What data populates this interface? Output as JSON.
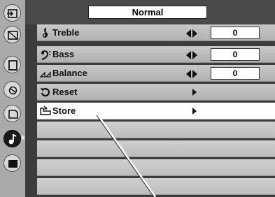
{
  "header": {
    "mode_value": "Normal"
  },
  "side_icons": [
    {
      "name": "input-icon"
    },
    {
      "name": "pc-adjust-icon"
    },
    {
      "name": "screen-icon"
    },
    {
      "name": "image-select-icon"
    },
    {
      "name": "image-adjust-icon"
    },
    {
      "name": "sound-icon",
      "active": true
    },
    {
      "name": "setting-icon"
    }
  ],
  "menu": {
    "items": [
      {
        "label": "Treble",
        "icon": "treble-clef-icon",
        "control": "adjust",
        "value": "0"
      },
      {
        "label": "Bass",
        "icon": "bass-clef-icon",
        "control": "adjust",
        "value": "0"
      },
      {
        "label": "Balance",
        "icon": "balance-icon",
        "control": "adjust",
        "value": "0"
      },
      {
        "label": "Reset",
        "icon": "reset-icon",
        "control": "arrow"
      },
      {
        "label": "Store",
        "icon": "store-icon",
        "control": "arrow",
        "selected": true
      }
    ]
  }
}
